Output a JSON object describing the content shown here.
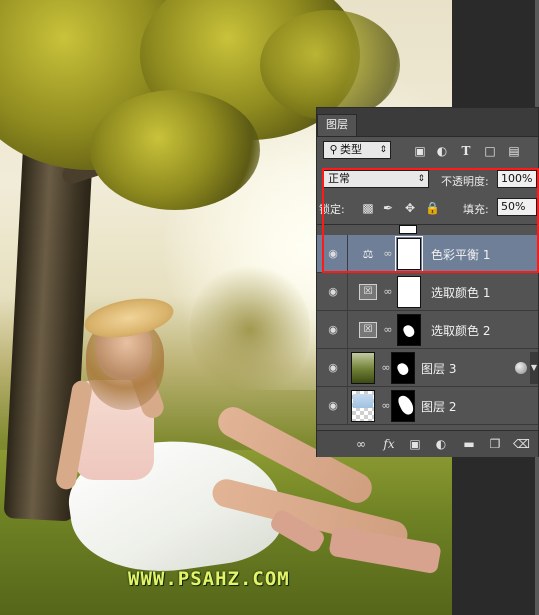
{
  "watermark": "WWW.PSAHZ.COM",
  "panel": {
    "tab_label": "图层",
    "filter": {
      "icon": "search-icon",
      "label": "类型",
      "icons": [
        "image-filter-icon",
        "adjustment-filter-icon",
        "text-filter-icon",
        "shape-filter-icon",
        "smart-object-filter-icon"
      ]
    },
    "blend_mode": "正常",
    "opacity_label": "不透明度:",
    "opacity_value": "100%",
    "lock_label": "锁定:",
    "lock_icons": [
      "lock-transparency-icon",
      "lock-paint-icon",
      "lock-position-icon",
      "lock-all-icon"
    ],
    "fill_label": "填充:",
    "fill_value": "50%",
    "layers": [
      {
        "name": "色彩平衡 1",
        "selected": true,
        "type": "adjustment",
        "icon": "scale-balance-icon",
        "mask": "white"
      },
      {
        "name": "选取颜色 1",
        "selected": false,
        "type": "adjustment",
        "icon": "selective-color-icon",
        "mask": "white"
      },
      {
        "name": "选取颜色 2",
        "selected": false,
        "type": "adjustment",
        "icon": "selective-color-icon",
        "mask": "black"
      },
      {
        "name": "图层 3",
        "selected": false,
        "type": "pixel",
        "mask": "black"
      },
      {
        "name": "图层 2",
        "selected": false,
        "type": "pixel",
        "mask": "black"
      }
    ],
    "bottom_icons": [
      "link-layers-icon",
      "fx-icon",
      "add-mask-icon",
      "new-adjustment-icon",
      "new-group-icon",
      "new-layer-icon",
      "trash-icon"
    ]
  },
  "colors": {
    "selected_row": "#6e7f97",
    "highlight": "#ff1a1a",
    "watermark": "#e6f26a"
  }
}
